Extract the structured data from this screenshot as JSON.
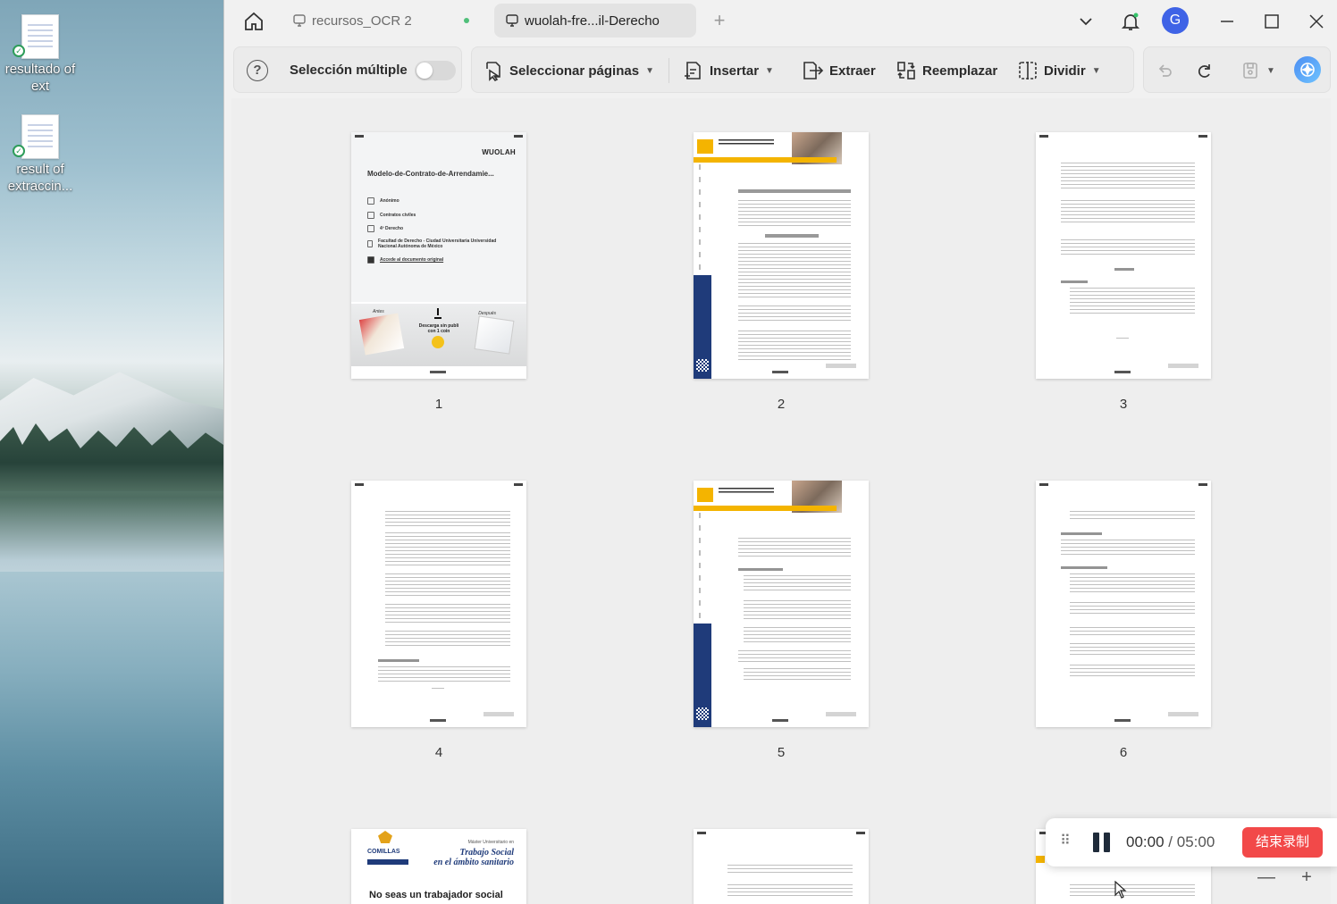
{
  "desktop": {
    "icons": [
      {
        "label": "resultado of ext"
      },
      {
        "label": "result of extraccin..."
      }
    ]
  },
  "titlebar": {
    "tabs": [
      {
        "label": "recursos_OCR 2",
        "active": false
      },
      {
        "label": "wuolah-fre...il-Derecho",
        "active": true
      }
    ],
    "new_tab": "+",
    "avatar_letter": "G"
  },
  "toolbar": {
    "multi_select_label": "Selección múltiple",
    "multi_select_on": false,
    "select_pages_label": "Seleccionar páginas",
    "insert_label": "Insertar",
    "extract_label": "Extraer",
    "replace_label": "Reemplazar",
    "split_label": "Dividir"
  },
  "pages": [
    {
      "number": "1",
      "type": "cover",
      "cover": {
        "brand": "WUOLAH",
        "title": "Modelo-de-Contrato-de-Arrendamie...",
        "rows": [
          "Anónimo",
          "Contratos civiles",
          "4º Derecho",
          "Facultad de Derecho - Ciudad Universitaria Universidad Nacional Autónoma de México",
          "Accede al documento original"
        ],
        "banner_text": "Descarga sin publi con 1 coin",
        "banner_left": "Antes",
        "banner_right": "Después"
      }
    },
    {
      "number": "2",
      "type": "ad"
    },
    {
      "number": "3",
      "type": "text"
    },
    {
      "number": "4",
      "type": "text"
    },
    {
      "number": "5",
      "type": "ad"
    },
    {
      "number": "6",
      "type": "text"
    },
    {
      "number": "",
      "type": "comillas",
      "comillas": {
        "logo": "COMILLAS",
        "line1": "Máster Universitario en",
        "line2": "Trabajo Social",
        "line3": "en el ámbito sanitario",
        "big_text": "No seas un trabajador social"
      }
    },
    {
      "number": "",
      "type": "text"
    },
    {
      "number": "",
      "type": "text"
    }
  ],
  "recorder": {
    "elapsed": "00:00",
    "separator": "/",
    "limit": "05:00",
    "stop_label": "结束录制"
  },
  "zoom": {
    "minus": "—",
    "plus": "+"
  }
}
